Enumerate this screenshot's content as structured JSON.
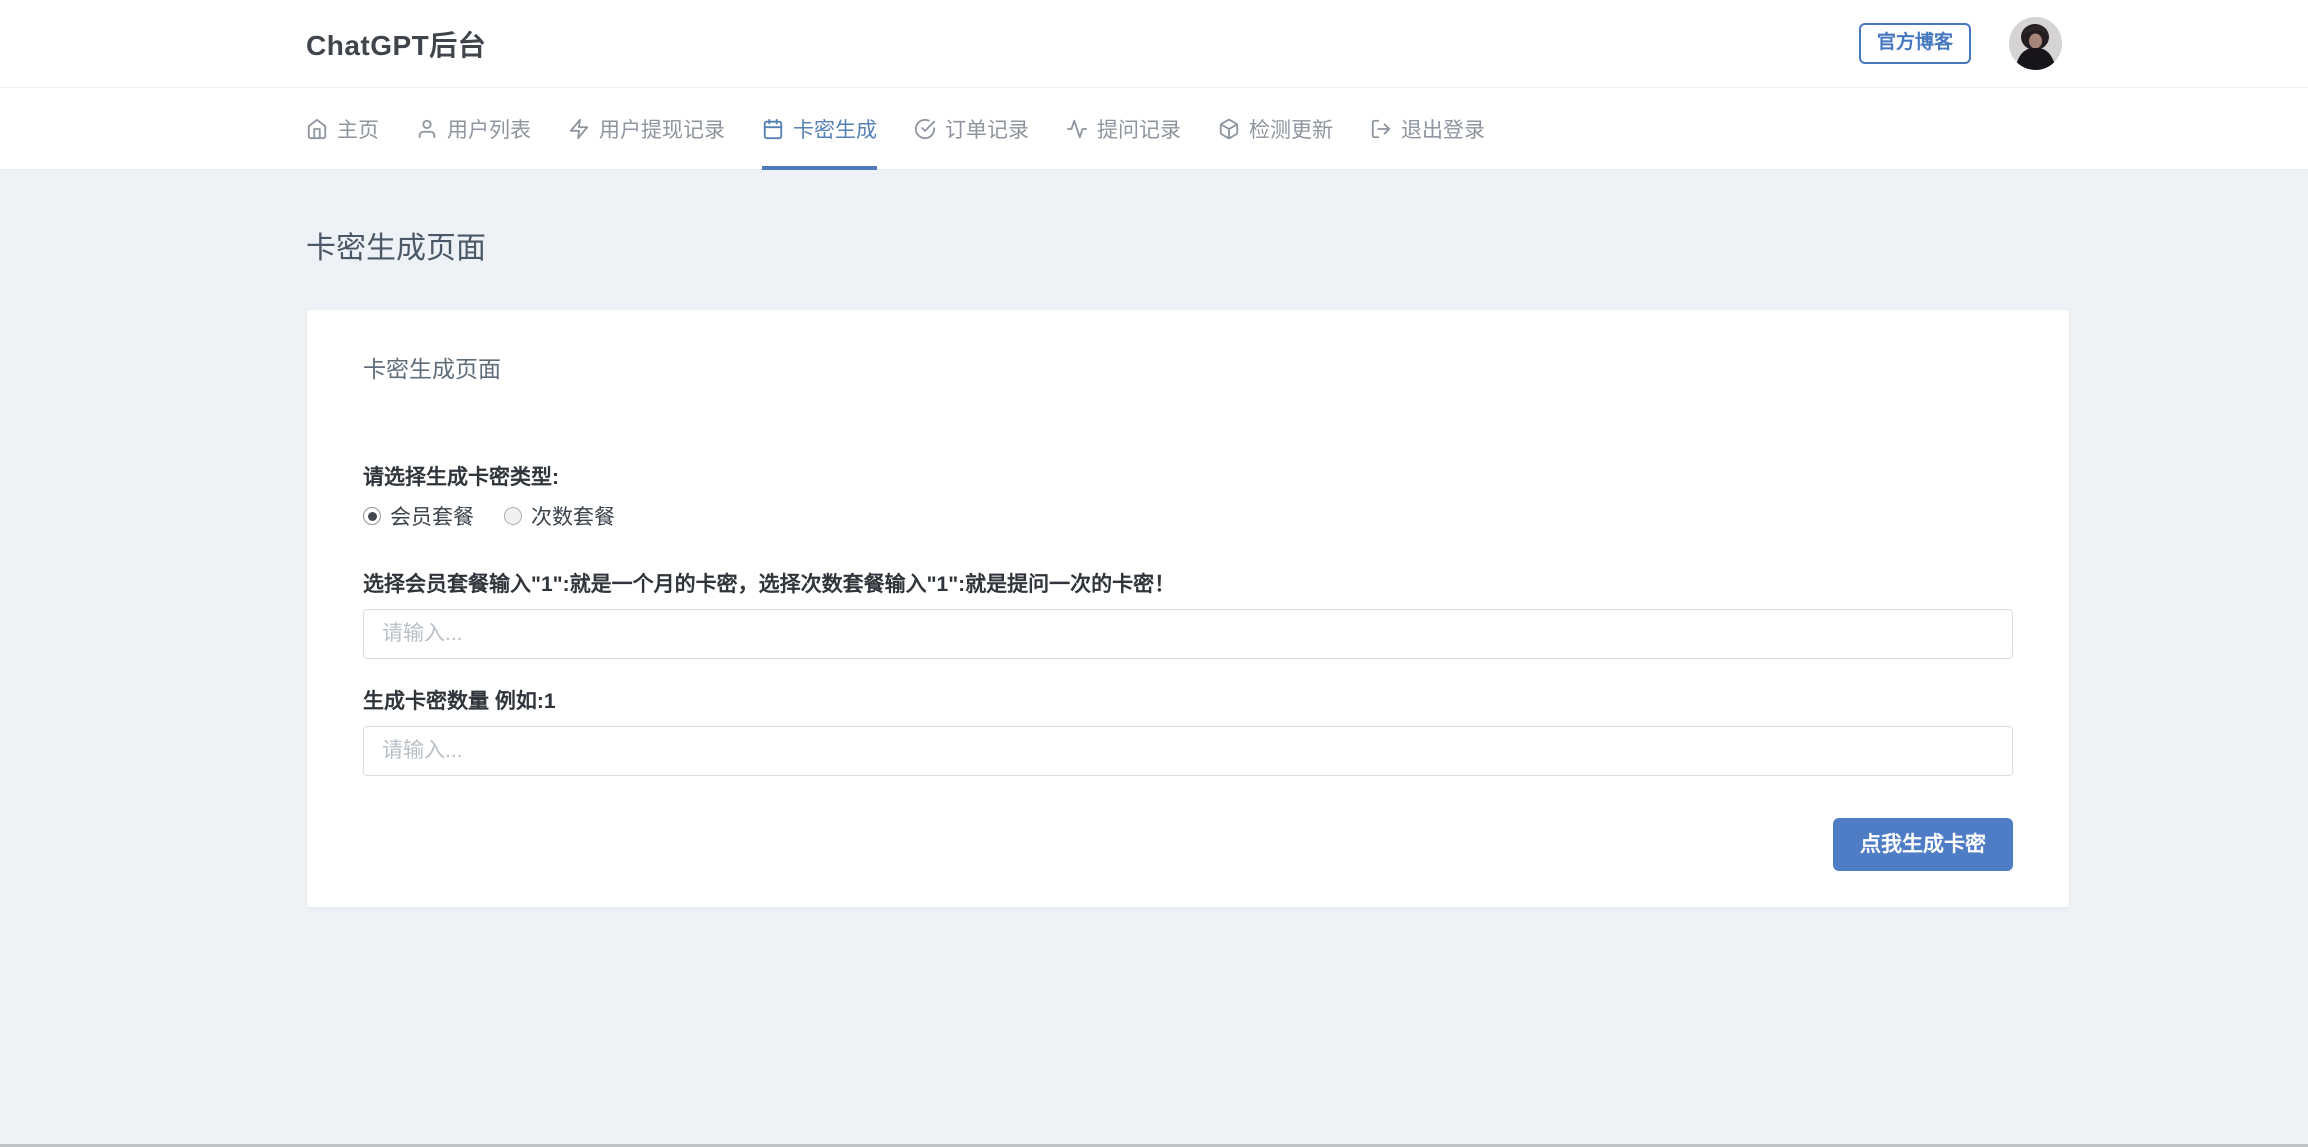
{
  "header": {
    "title": "ChatGPT后台",
    "blog_button_label": "官方博客"
  },
  "nav": {
    "items": [
      {
        "id": "home",
        "label": "主页",
        "icon": "home-icon",
        "active": false
      },
      {
        "id": "user-list",
        "label": "用户列表",
        "icon": "user-icon",
        "active": false
      },
      {
        "id": "withdraw-records",
        "label": "用户提现记录",
        "icon": "zap-icon",
        "active": false
      },
      {
        "id": "card-key-generate",
        "label": "卡密生成",
        "icon": "calendar-icon",
        "active": true
      },
      {
        "id": "order-records",
        "label": "订单记录",
        "icon": "check-circle-icon",
        "active": false
      },
      {
        "id": "question-records",
        "label": "提问记录",
        "icon": "activity-icon",
        "active": false
      },
      {
        "id": "check-update",
        "label": "检测更新",
        "icon": "package-icon",
        "active": false
      },
      {
        "id": "logout",
        "label": "退出登录",
        "icon": "logout-icon",
        "active": false
      }
    ]
  },
  "page": {
    "title": "卡密生成页面"
  },
  "card": {
    "title": "卡密生成页面",
    "type_label": "请选择生成卡密类型:",
    "radio_options": [
      {
        "label": "会员套餐",
        "selected": true
      },
      {
        "label": "次数套餐",
        "selected": false
      }
    ],
    "hint_label": "选择会员套餐输入\"1\":就是一个月的卡密，选择次数套餐输入\"1\":就是提问一次的卡密！",
    "value_input": {
      "value": "",
      "placeholder": "请输入..."
    },
    "quantity_label": "生成卡密数量 例如:1",
    "quantity_input": {
      "value": "",
      "placeholder": "请输入..."
    },
    "submit_button_label": "点我生成卡密"
  },
  "colors": {
    "accent_blue": "#4e7cc5",
    "nav_active_blue": "#5581b5",
    "outline_button_blue": "#4678bf",
    "page_background": "#eef2f6"
  }
}
